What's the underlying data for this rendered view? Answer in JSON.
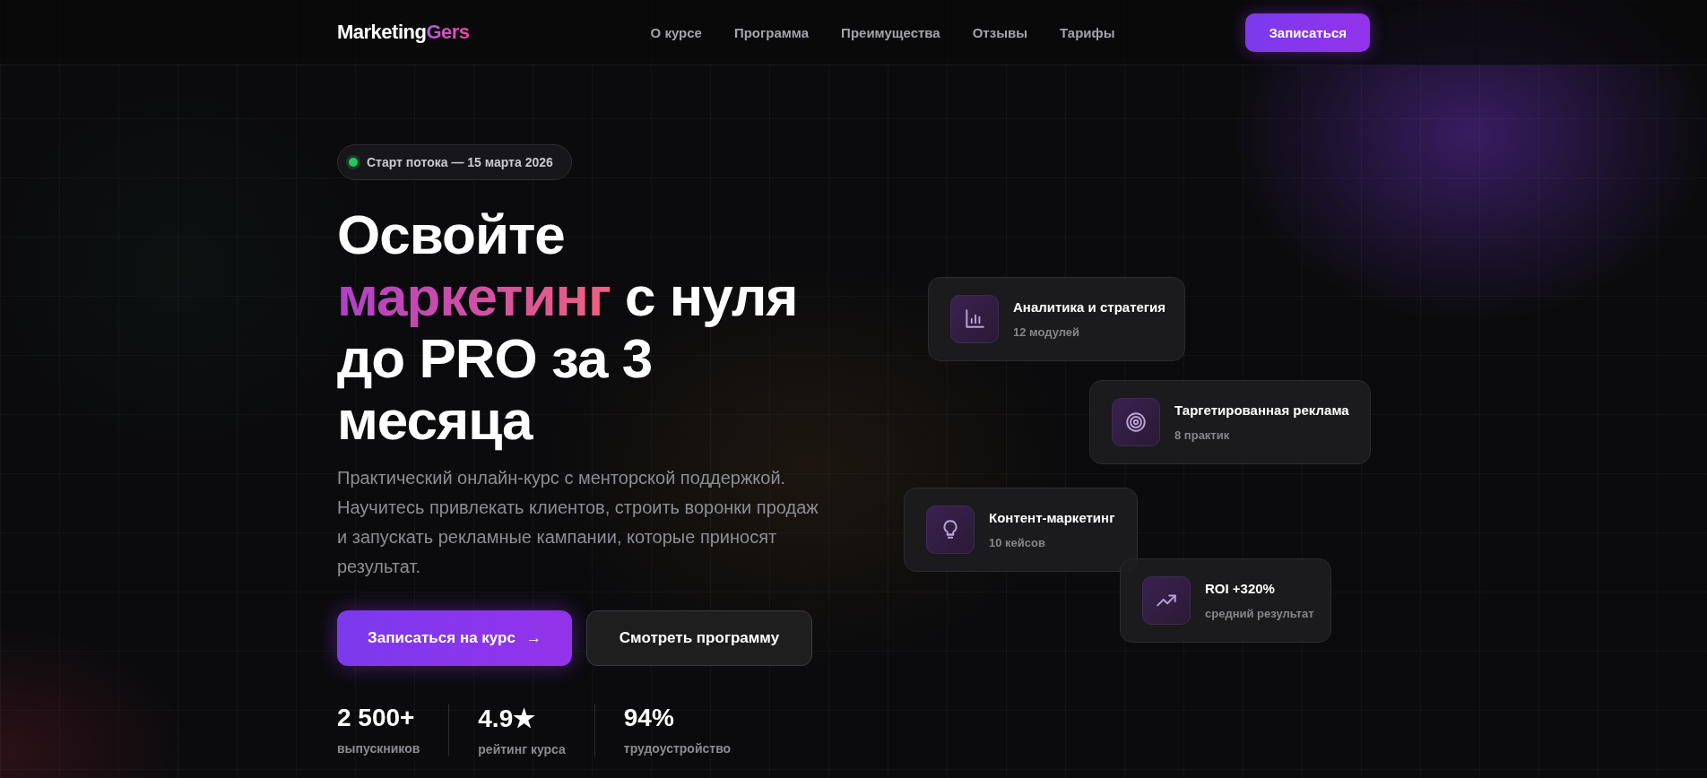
{
  "header": {
    "logo": {
      "main": "Marketing",
      "accent": "Gers"
    },
    "nav": [
      {
        "label": "О курсе"
      },
      {
        "label": "Программа"
      },
      {
        "label": "Преимущества"
      },
      {
        "label": "Отзывы"
      },
      {
        "label": "Тарифы"
      }
    ],
    "cta": "Записаться"
  },
  "hero": {
    "badge": "Старт потока — 15 марта 2026",
    "title_before": "Освойте",
    "title_accent": "маркетинг",
    "title_after": "с нуля до PRO за 3 месяца",
    "description": "Практический онлайн-курс с менторской поддержкой. Научитесь привлекать клиентов, строить воронки продаж и запускать рекламные кампании, которые приносят результат.",
    "buttons": [
      {
        "kind": "primary",
        "label": "Записаться на курс",
        "arrow": "→"
      },
      {
        "kind": "secondary",
        "label": "Смотреть программу"
      }
    ],
    "stats": [
      {
        "value": "2 500+",
        "label": "выпускников"
      },
      {
        "value": "4.9★",
        "label": "рейтинг курса"
      },
      {
        "value": "94%",
        "label": "трудоустройство"
      }
    ]
  },
  "cards": [
    {
      "title": "Аналитика и стратегия",
      "subtitle": "12 модулей"
    },
    {
      "title": "Таргетированная реклама",
      "subtitle": "8 практик"
    },
    {
      "title": "Контент-маркетинг",
      "subtitle": "10 кейсов"
    },
    {
      "title": "ROI +320%",
      "subtitle": "средний результат"
    }
  ]
}
